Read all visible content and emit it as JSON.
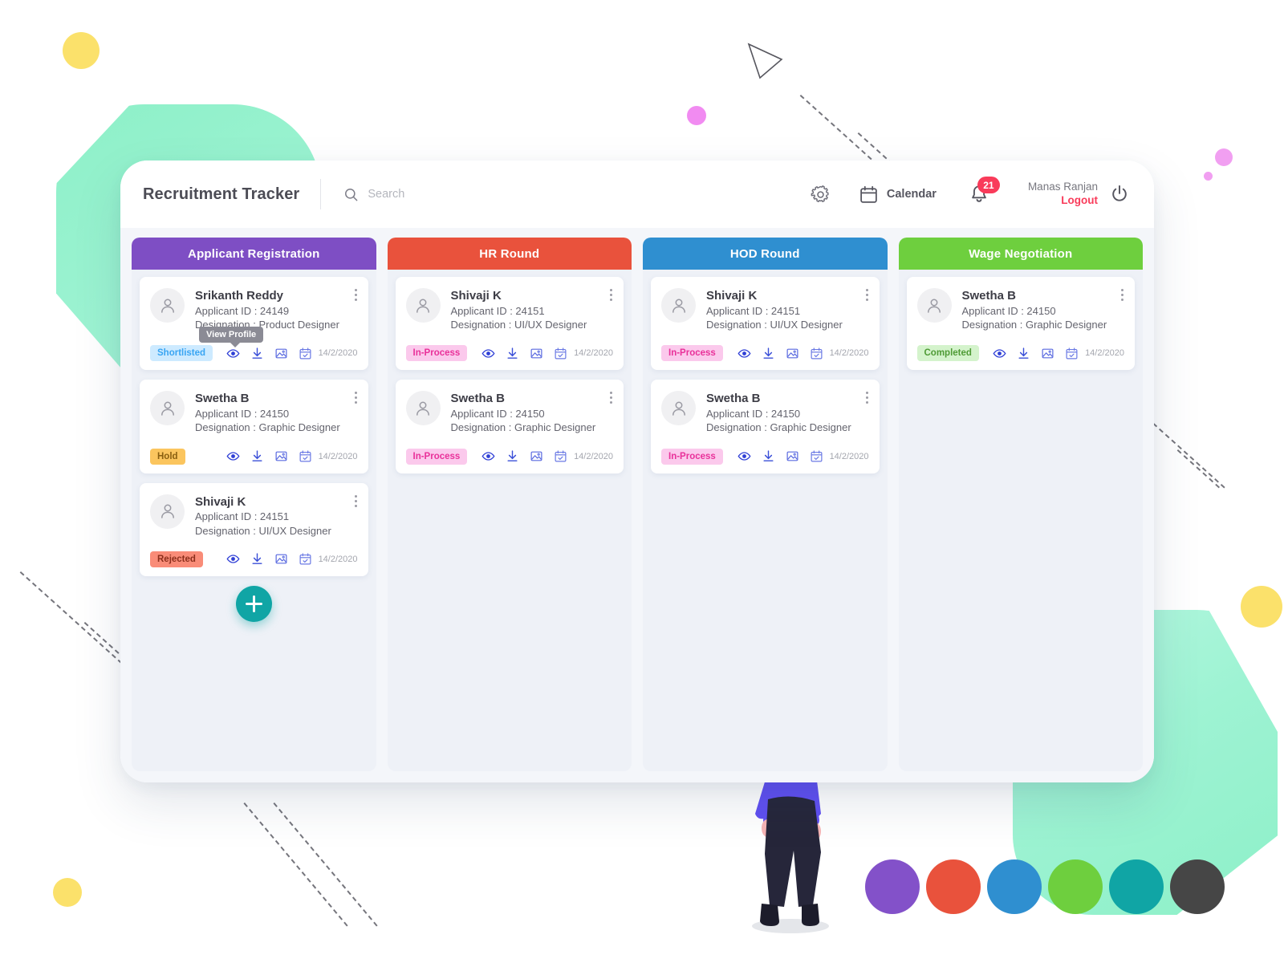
{
  "header": {
    "brand_title": "Recruitment Tracker",
    "search": {
      "placeholder": "Search",
      "value": ""
    },
    "gear_icon": "gear-icon",
    "calendar_label": "Calendar",
    "calendar_icon": "calendar-icon",
    "bell_icon": "bell-icon",
    "notification_count": "21",
    "user_name": "Manas Ranjan",
    "logout_label": "Logout",
    "power_icon": "power-icon"
  },
  "tooltip": {
    "text": "View Profile"
  },
  "add_button": {
    "label": "+",
    "name": "add-applicant-button",
    "color": "#10a5a5"
  },
  "card_icons": {
    "view": "eye-icon",
    "download": "download-icon",
    "image": "image-icon",
    "calendar": "calendar-check-icon"
  },
  "columns": [
    {
      "title": "Applicant Registration",
      "color": "#7e4ec4",
      "has_add_button": true,
      "cards": [
        {
          "name": "Srikanth Reddy",
          "applicant_id": "Applicant ID : 24149",
          "designation": "Designation : Product Designer",
          "status": "Shortlisted",
          "status_bg": "#cdeaff",
          "status_fg": "#39a5f3",
          "date": "14/2/2020",
          "tooltip": true
        },
        {
          "name": "Swetha B",
          "applicant_id": "Applicant ID : 24150",
          "designation": "Designation : Graphic Designer",
          "status": "Hold",
          "status_bg": "#fbc55e",
          "status_fg": "#8a5f10",
          "date": "14/2/2020",
          "tooltip": false
        },
        {
          "name": "Shivaji K",
          "applicant_id": "Applicant ID : 24151",
          "designation": "Designation : UI/UX Designer",
          "status": "Rejected",
          "status_bg": "#f98c78",
          "status_fg": "#8c2f1c",
          "date": "14/2/2020",
          "tooltip": false
        }
      ]
    },
    {
      "title": "HR Round",
      "color": "#e9523c",
      "has_add_button": false,
      "cards": [
        {
          "name": "Shivaji K",
          "applicant_id": "Applicant ID : 24151",
          "designation": "Designation : UI/UX Designer",
          "status": "In-Process",
          "status_bg": "#fbc9ec",
          "status_fg": "#e9319a",
          "date": "14/2/2020",
          "tooltip": false
        },
        {
          "name": "Swetha B",
          "applicant_id": "Applicant ID : 24150",
          "designation": "Designation : Graphic Designer",
          "status": "In-Process",
          "status_bg": "#fbc9ec",
          "status_fg": "#e9319a",
          "date": "14/2/2020",
          "tooltip": false
        }
      ]
    },
    {
      "title": "HOD Round",
      "color": "#2f8fd0",
      "has_add_button": false,
      "cards": [
        {
          "name": "Shivaji K",
          "applicant_id": "Applicant ID : 24151",
          "designation": "Designation : UI/UX Designer",
          "status": "In-Process",
          "status_bg": "#fbc9ec",
          "status_fg": "#e9319a",
          "date": "14/2/2020",
          "tooltip": false
        },
        {
          "name": "Swetha B",
          "applicant_id": "Applicant ID : 24150",
          "designation": "Designation : Graphic Designer",
          "status": "In-Process",
          "status_bg": "#fbc9ec",
          "status_fg": "#e9319a",
          "date": "14/2/2020",
          "tooltip": false
        }
      ]
    },
    {
      "title": "Wage Negotiation",
      "color": "#6ecf3e",
      "has_add_button": false,
      "cards": [
        {
          "name": "Swetha B",
          "applicant_id": "Applicant ID : 24150",
          "designation": "Designation : Graphic Designer",
          "status": "Completed",
          "status_bg": "#d4f3cc",
          "status_fg": "#4f9b36",
          "date": "14/2/2020",
          "tooltip": false
        }
      ]
    }
  ],
  "palette": [
    "#8351c9",
    "#e9523c",
    "#2f8fd0",
    "#6ecf3e",
    "#10a5a5",
    "#464646"
  ],
  "decor": {
    "mint": "#9ef3d3",
    "yellow": "#fbe16b",
    "pink": "#f19ff1"
  }
}
